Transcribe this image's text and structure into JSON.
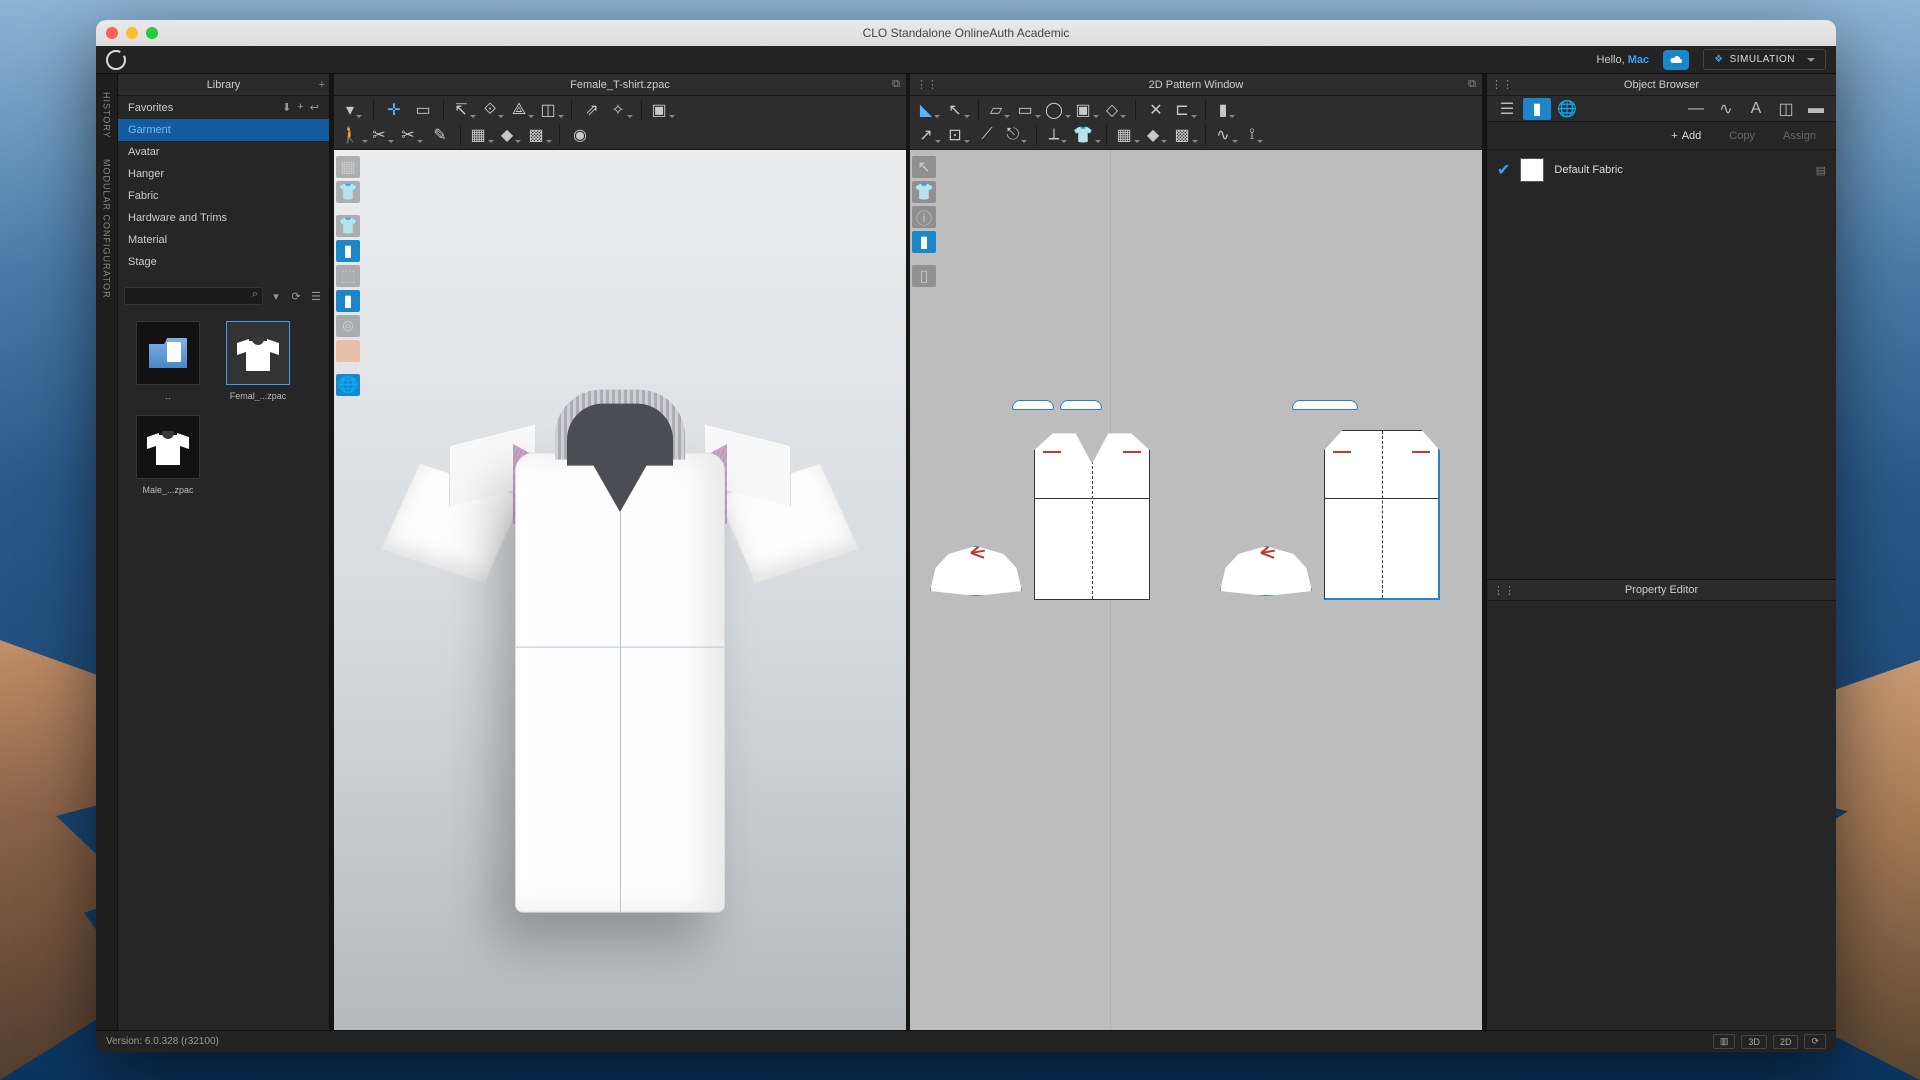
{
  "window": {
    "title": "CLO Standalone OnlineAuth Academic"
  },
  "topbar": {
    "hello_prefix": "Hello, ",
    "user": "Mac",
    "mode_label": "SIMULATION"
  },
  "side_tabs": {
    "history": "HISTORY",
    "modular": "MODULAR CONFIGURATOR"
  },
  "library": {
    "title": "Library",
    "items": [
      {
        "label": "Favorites",
        "favorites": true
      },
      {
        "label": "Garment",
        "selected": true
      },
      {
        "label": "Avatar"
      },
      {
        "label": "Hanger"
      },
      {
        "label": "Fabric"
      },
      {
        "label": "Hardware and Trims"
      },
      {
        "label": "Material"
      },
      {
        "label": "Stage"
      }
    ],
    "thumbs": [
      {
        "label": "..",
        "kind": "folder"
      },
      {
        "label": "Femal_...zpac",
        "kind": "tee",
        "selected": true
      },
      {
        "label": "Male_...zpac",
        "kind": "tee"
      }
    ]
  },
  "viewport3d": {
    "tab_title": "Female_T-shirt.zpac"
  },
  "viewport2d": {
    "tab_title": "2D Pattern Window"
  },
  "object_browser": {
    "title": "Object Browser",
    "actions": {
      "add": "Add",
      "copy": "Copy",
      "assign": "Assign"
    },
    "rows": [
      {
        "name": "Default Fabric"
      }
    ]
  },
  "property_editor": {
    "title": "Property Editor"
  },
  "footer": {
    "version": "Version: 6.0.328 (r32100)",
    "btn_3d": "3D",
    "btn_2d": "2D"
  }
}
